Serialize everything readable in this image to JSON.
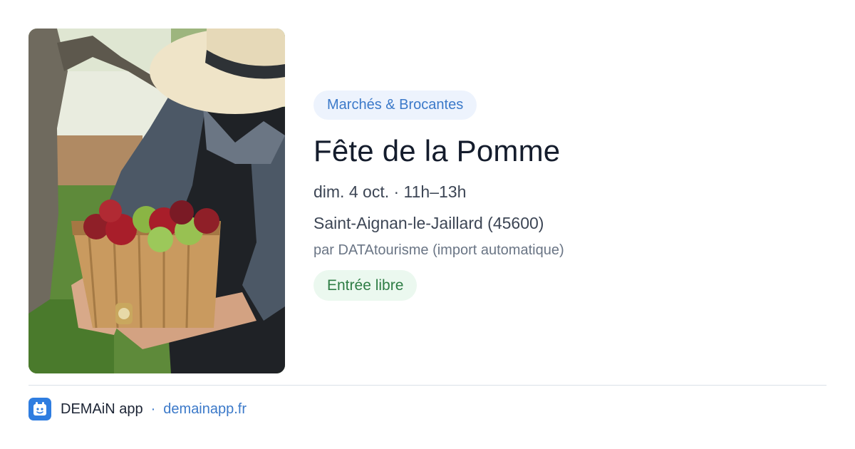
{
  "event": {
    "category": "Marchés & Brocantes",
    "title": "Fête de la Pomme",
    "datetime": "dim. 4 oct. · 11h–13h",
    "location": "Saint-Aignan-le-Jaillard (45600)",
    "source": "par DATAtourisme (import automatique)",
    "price": "Entrée libre",
    "image_icon": "photo-woman-apple-basket"
  },
  "footer": {
    "app_name": "DEMAiN app",
    "separator": "·",
    "link": "demainapp.fr",
    "logo_icon": "demain-logo-icon"
  },
  "colors": {
    "accent_blue": "#3b79c9",
    "pill_blue_bg": "#edf3fd",
    "green": "#2e7d45",
    "pill_green_bg": "#ebf8ef",
    "logo_bg": "#2f7de0"
  }
}
